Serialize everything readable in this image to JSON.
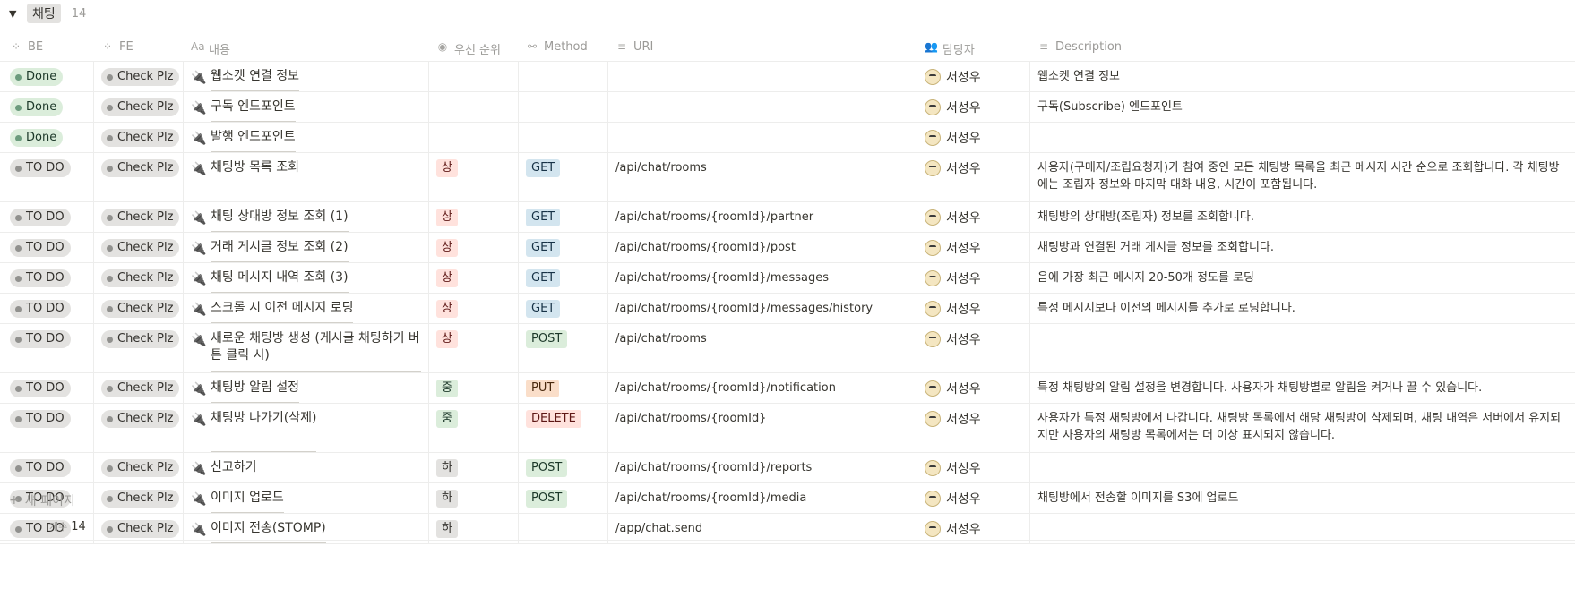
{
  "group": {
    "toggle": "▼",
    "label": "채팅",
    "count": "14"
  },
  "columns": [
    {
      "icon": "⁘",
      "label": "BE"
    },
    {
      "icon": "⁘",
      "label": "FE"
    },
    {
      "icon": "Aa",
      "label": "내용"
    },
    {
      "icon": "◉",
      "label": "우선 순위"
    },
    {
      "icon": "⚯",
      "label": "Method"
    },
    {
      "icon": "≡",
      "label": "URI"
    },
    {
      "icon": "👥",
      "label": "담당자"
    },
    {
      "icon": "≡",
      "label": "Description"
    }
  ],
  "rows": [
    {
      "be": "Done",
      "fe": "Check Plz",
      "title": "웹소켓 연결 정보",
      "priority": "",
      "method": "",
      "uri": "",
      "owner": "서성우",
      "desc": "웹소켓 연결 정보"
    },
    {
      "be": "Done",
      "fe": "Check Plz",
      "title": "구독 엔드포인트",
      "priority": "",
      "method": "",
      "uri": "",
      "owner": "서성우",
      "desc": "구독(Subscribe) 엔드포인트"
    },
    {
      "be": "Done",
      "fe": "Check Plz",
      "title": "발행 엔드포인트",
      "priority": "",
      "method": "",
      "uri": "",
      "owner": "서성우",
      "desc": ""
    },
    {
      "be": "TO DO",
      "fe": "Check Plz",
      "title": "채팅방 목록 조회",
      "priority": "상",
      "method": "GET",
      "uri": "/api/chat/rooms",
      "owner": "서성우",
      "desc": " 사용자(구매자/조립요청자)가 참여 중인 모든 채팅방 목록을 최근 메시지 시간 순으로 조회합니다. 각 채팅방에는 조립자 정보와 마지막 대화 내용, 시간이 포함됩니다."
    },
    {
      "be": "TO DO",
      "fe": "Check Plz",
      "title": "채팅 상대방 정보 조회 (1)",
      "priority": "상",
      "method": "GET",
      "uri": "/api/chat/rooms/{roomId}/partner",
      "owner": "서성우",
      "desc": "채팅방의 상대방(조립자) 정보를 조회합니다."
    },
    {
      "be": "TO DO",
      "fe": "Check Plz",
      "title": "거래 게시글 정보 조회 (2)",
      "priority": "상",
      "method": "GET",
      "uri": "/api/chat/rooms/{roomId}/post",
      "owner": "서성우",
      "desc": "채팅방과 연결된 거래 게시글 정보를 조회합니다."
    },
    {
      "be": "TO DO",
      "fe": "Check Plz",
      "title": "채팅 메시지 내역 조회 (3)",
      "priority": "상",
      "method": "GET",
      "uri": "/api/chat/rooms/{roomId}/messages",
      "owner": "서성우",
      "desc": "음에 가장 최근 메시지 20-50개 정도를 로딩"
    },
    {
      "be": "TO DO",
      "fe": "Check Plz",
      "title": "스크롤 시 이전 메시지 로딩",
      "priority": "상",
      "method": "GET",
      "uri": "/api/chat/rooms/{roomId}/messages/history",
      "owner": "서성우",
      "desc": "특정 메시지보다 이전의 메시지를 추가로 로딩합니다."
    },
    {
      "be": "TO DO",
      "fe": "Check Plz",
      "title": "새로운 채팅방 생성 (게시글 채팅하기 버튼 클릭 시)",
      "priority": "상",
      "method": "POST",
      "uri": "/api/chat/rooms",
      "owner": "서성우",
      "desc": ""
    },
    {
      "be": "TO DO",
      "fe": "Check Plz",
      "title": "채팅방 알림 설정",
      "priority": "중",
      "method": "PUT",
      "uri": "/api/chat/rooms/{roomId}/notification",
      "owner": "서성우",
      "desc": "특정 채팅방의 알림 설정을 변경합니다. 사용자가 채팅방별로 알림을 켜거나 끌 수 있습니다."
    },
    {
      "be": "TO DO",
      "fe": "Check Plz",
      "title": "채팅방 나가기(삭제)",
      "priority": "중",
      "method": "DELETE",
      "uri": "/api/chat/rooms/{roomId}",
      "owner": "서성우",
      "desc": "사용자가 특정 채팅방에서 나갑니다. 채팅방 목록에서 해당 채팅방이 삭제되며, 채팅 내역은 서버에서 유지되지만 사용자의 채팅방 목록에서는 더 이상 표시되지 않습니다."
    },
    {
      "be": "TO DO",
      "fe": "Check Plz",
      "title": "신고하기",
      "priority": "하",
      "method": "POST",
      "uri": "/api/chat/rooms/{roomId}/reports",
      "owner": "서성우",
      "desc": ""
    },
    {
      "be": "TO DO",
      "fe": "Check Plz",
      "title": "이미지 업로드",
      "priority": "하",
      "method": "POST",
      "uri": "/api/chat/rooms/{roomId}/media",
      "owner": "서성우",
      "desc": "채팅방에서 전송할 이미지를 S3에 업로드"
    },
    {
      "be": "TO DO",
      "fe": "Check Plz",
      "title": "이미지 전송(STOMP)",
      "priority": "하",
      "method": "",
      "uri": "/app/chat.send",
      "owner": "서성우",
      "desc": ""
    }
  ],
  "row_heights": [
    "s",
    "s",
    "s",
    "t",
    "s",
    "s",
    "s",
    "s",
    "t",
    "s",
    "t",
    "s",
    "s",
    "s"
  ],
  "new_page": {
    "icon": "+",
    "label": "새 페이지"
  },
  "footer": {
    "count_label": "개수",
    "count_value": "14"
  },
  "colors": {
    "priority": {
      "상": "red",
      "중": "green",
      "하": "gray"
    },
    "method": {
      "GET": "blue",
      "POST": "green",
      "PUT": "orange",
      "DELETE": "red"
    }
  }
}
